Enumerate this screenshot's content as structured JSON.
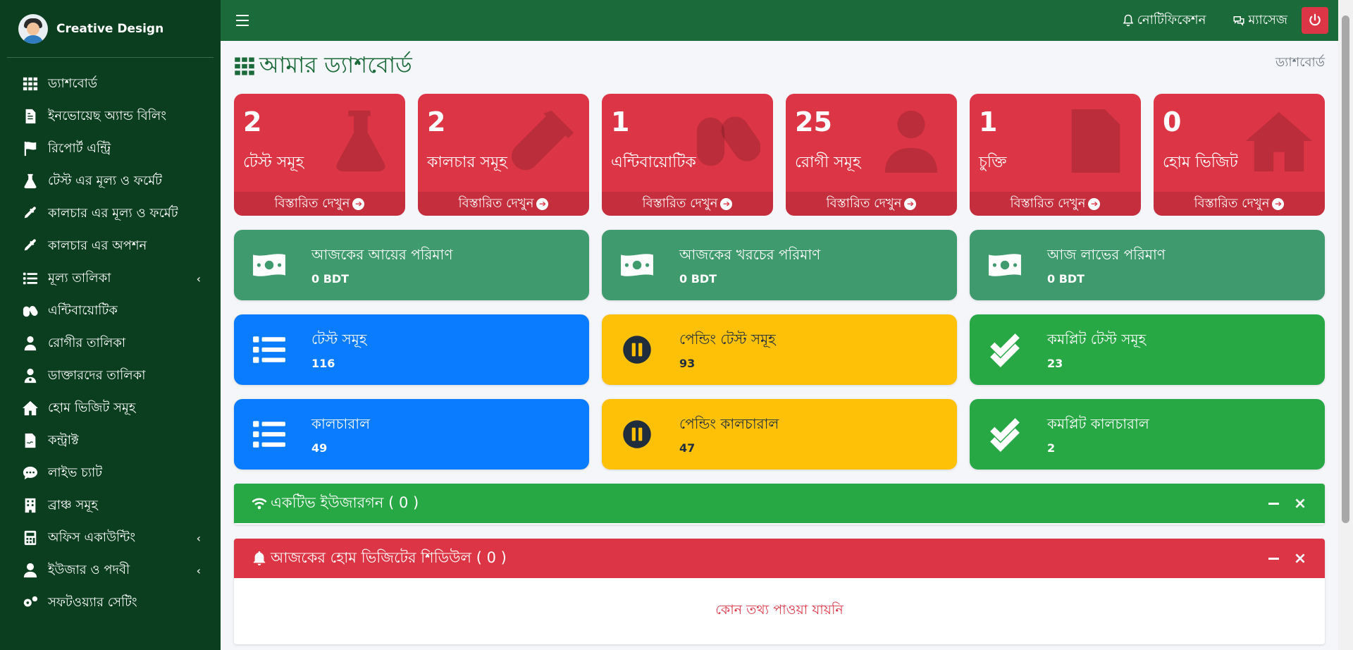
{
  "brand": {
    "name": "Creative Design"
  },
  "sidebar": {
    "items": [
      {
        "label": "ড্যাশবোর্ড",
        "icon": "grid-icon",
        "has_submenu": false
      },
      {
        "label": "ইনভোয়েছ অ্যান্ড বিলিং",
        "icon": "invoice-icon",
        "has_submenu": false
      },
      {
        "label": "রিপোর্ট এন্ট্রি",
        "icon": "flag-icon",
        "has_submenu": false
      },
      {
        "label": "টেস্ট এর মূল্য ও ফর্মেট",
        "icon": "flask-icon",
        "has_submenu": false
      },
      {
        "label": "কালচার এর মূল্য ও ফর্মেট",
        "icon": "eyedropper-icon",
        "has_submenu": false
      },
      {
        "label": "কালচার এর অপশন",
        "icon": "eyedropper-icon",
        "has_submenu": false
      },
      {
        "label": "মূল্য তালিকা",
        "icon": "list-icon",
        "has_submenu": true
      },
      {
        "label": "এন্টিবায়োটিক",
        "icon": "capsules-icon",
        "has_submenu": false
      },
      {
        "label": "রোগীর তালিকা",
        "icon": "patient-icon",
        "has_submenu": false
      },
      {
        "label": "ডাক্তারদের তালিকা",
        "icon": "doctor-icon",
        "has_submenu": false
      },
      {
        "label": "হোম ভিজিট সমূহ",
        "icon": "home-icon",
        "has_submenu": false
      },
      {
        "label": "কন্ট্রাক্ট",
        "icon": "contract-icon",
        "has_submenu": false
      },
      {
        "label": "লাইভ চ্যাট",
        "icon": "chat-icon",
        "has_submenu": false
      },
      {
        "label": "ব্রাঞ্চ সমূহ",
        "icon": "building-icon",
        "has_submenu": false
      },
      {
        "label": "অফিস একাউন্টিং",
        "icon": "calculator-icon",
        "has_submenu": true
      },
      {
        "label": "ইউজার ও পদবী",
        "icon": "user-icon",
        "has_submenu": true
      },
      {
        "label": "সফটওয়্যার সেটিং",
        "icon": "gears-icon",
        "has_submenu": false
      }
    ],
    "chevron": "‹"
  },
  "topbar": {
    "notifications_label": "নোটিফিকেশন",
    "messages_label": "ম্যাসেজ"
  },
  "page": {
    "title": "আমার ড্যাশবোর্ড",
    "breadcrumb": "ড্যাশবোর্ড"
  },
  "small_boxes": [
    {
      "value": "2",
      "label": "টেস্ট সমূহ",
      "link": "বিস্তারিত দেখুন",
      "icon": "flask-icon"
    },
    {
      "value": "2",
      "label": "কালচার সমূহ",
      "link": "বিস্তারিত দেখুন",
      "icon": "vial-icon"
    },
    {
      "value": "1",
      "label": "এন্টিবায়োটিক",
      "link": "বিস্তারিত দেখুন",
      "icon": "capsules-icon"
    },
    {
      "value": "25",
      "label": "রোগী সমূহ",
      "link": "বিস্তারিত দেখুন",
      "icon": "patient-icon"
    },
    {
      "value": "1",
      "label": "চুক্তি",
      "link": "বিস্তারিত দেখুন",
      "icon": "contract-icon"
    },
    {
      "value": "0",
      "label": "হোম ভিজিট",
      "link": "বিস্তারিত দেখুন",
      "icon": "home-icon"
    }
  ],
  "finance_boxes": [
    {
      "label": "আজকের আয়ের পরিমাণ",
      "value": "0 BDT",
      "icon": "money-bill-icon"
    },
    {
      "label": "আজকের খরচের পরিমাণ",
      "value": "0 BDT",
      "icon": "money-bill-icon"
    },
    {
      "label": "আজ লাভের পরিমাণ",
      "value": "0 BDT",
      "icon": "money-bill-icon"
    }
  ],
  "test_boxes": [
    {
      "label": "টেস্ট সমূহ",
      "value": "116",
      "icon": "list-icon",
      "color": "#0a7cff"
    },
    {
      "label": "পেন্ডিং টেস্ট সমূহ",
      "value": "93",
      "icon": "pause-circle-icon",
      "color": "#ffc107"
    },
    {
      "label": "কমপ্লিট টেস্ট সমূহ",
      "value": "23",
      "icon": "double-check-icon",
      "color": "#28a745"
    }
  ],
  "culture_boxes": [
    {
      "label": "কালচারাল",
      "value": "49",
      "icon": "list-icon",
      "color": "#0a7cff"
    },
    {
      "label": "পেন্ডিং কালচারাল",
      "value": "47",
      "icon": "pause-circle-icon",
      "color": "#ffc107"
    },
    {
      "label": "কমপ্লিট কালচারাল",
      "value": "2",
      "icon": "double-check-icon",
      "color": "#28a745"
    }
  ],
  "active_users_card": {
    "title": "একটিভ ইউজারগন ( 0 )",
    "icon": "wifi-icon",
    "color": "#28a745"
  },
  "home_visit_card": {
    "title": "আজকের হোম ভিজিটের শিডিউল ( 0 )",
    "icon": "bell-icon",
    "color": "#dc3545",
    "empty_text": "কোন তথ্য পাওয়া যায়নি"
  },
  "colors": {
    "sidebar_bg": "#0b3d1f",
    "topbar_bg": "#1b6a39",
    "danger": "#dc3545",
    "success": "#28a745",
    "primary": "#0a7cff",
    "warning": "#ffc107",
    "teal": "#3f9a6e"
  }
}
